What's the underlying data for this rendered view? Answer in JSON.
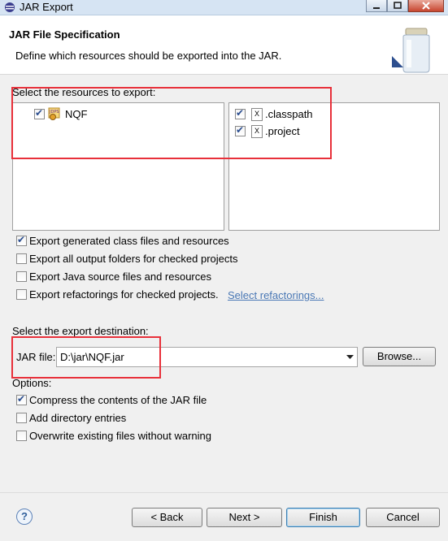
{
  "window": {
    "title": "JAR Export"
  },
  "header": {
    "title": "JAR File Specification",
    "description": "Define which resources should be exported into the JAR."
  },
  "resources": {
    "label": "Select the resources to export:",
    "tree": [
      {
        "label": "NQF",
        "checked": true,
        "icon": "java-project-icon"
      }
    ],
    "files": [
      {
        "label": ".classpath",
        "checked": true,
        "icon": "xml-file-icon"
      },
      {
        "label": ".project",
        "checked": true,
        "icon": "xml-file-icon"
      }
    ]
  },
  "export_options": [
    {
      "label": "Export generated class files and resources",
      "checked": true
    },
    {
      "label": "Export all output folders for checked projects",
      "checked": false
    },
    {
      "label": "Export Java source files and resources",
      "checked": false
    },
    {
      "label": "Export refactorings for checked projects.",
      "checked": false
    }
  ],
  "select_refactorings_link": "Select refactorings...",
  "destination": {
    "label": "Select the export destination:",
    "jar_file_label": "JAR file:",
    "jar_file_value": "D:\\jar\\NQF.jar",
    "browse_label": "Browse..."
  },
  "options": {
    "label": "Options:",
    "items": [
      {
        "label": "Compress the contents of the JAR file",
        "checked": true
      },
      {
        "label": "Add directory entries",
        "checked": false
      },
      {
        "label": "Overwrite existing files without warning",
        "checked": false
      }
    ]
  },
  "footer": {
    "back_label": "< Back",
    "next_label": "Next >",
    "finish_label": "Finish",
    "cancel_label": "Cancel"
  },
  "colors": {
    "annotation_red": "#e8303a",
    "link": "#4a78b5"
  }
}
